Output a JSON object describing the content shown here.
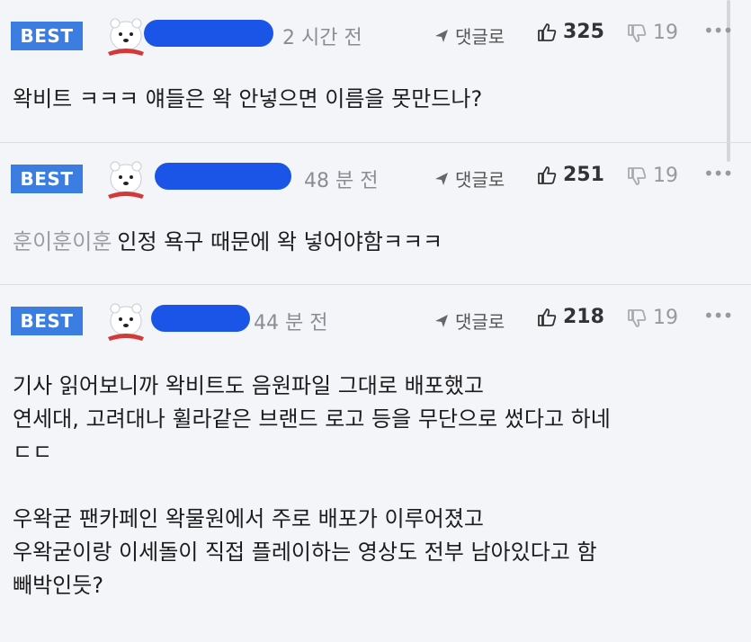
{
  "comments": [
    {
      "badge": "BEST",
      "time": "2 시간 전",
      "reply_label": "댓글로",
      "likes": "325",
      "dislikes": "19",
      "more": "•••",
      "mention": "",
      "lines": [
        "왁비트 ㅋㅋㅋ 얘들은 왁 안넣으면 이름을 못만드나?"
      ]
    },
    {
      "badge": "BEST",
      "time": "48 분 전",
      "reply_label": "댓글로",
      "likes": "251",
      "dislikes": "19",
      "more": "•••",
      "mention": "훈이훈이훈",
      "lines": [
        "인정 욕구 때문에 왁 넣어야함ㅋㅋㅋ"
      ]
    },
    {
      "badge": "BEST",
      "time": "44 분 전",
      "reply_label": "댓글로",
      "likes": "218",
      "dislikes": "19",
      "more": "•••",
      "mention": "",
      "lines": [
        "기사 읽어보니까 왁비트도 음원파일 그대로 배포했고",
        "연세대, 고려대나 휠라같은 브랜드 로고 등을 무단으로 썼다고 하네",
        "ㄷㄷ",
        "",
        "우왁굳 팬카페인 왁물원에서 주로 배포가 이루어졌고",
        "우왁굳이랑 이세돌이 직접 플레이하는 영상도 전부 남아있다고 함",
        "빼박인듯?"
      ]
    }
  ],
  "colors": {
    "badge": "#3b7de0",
    "redaction": "#1b55e8",
    "background": "#f4f5f9"
  }
}
